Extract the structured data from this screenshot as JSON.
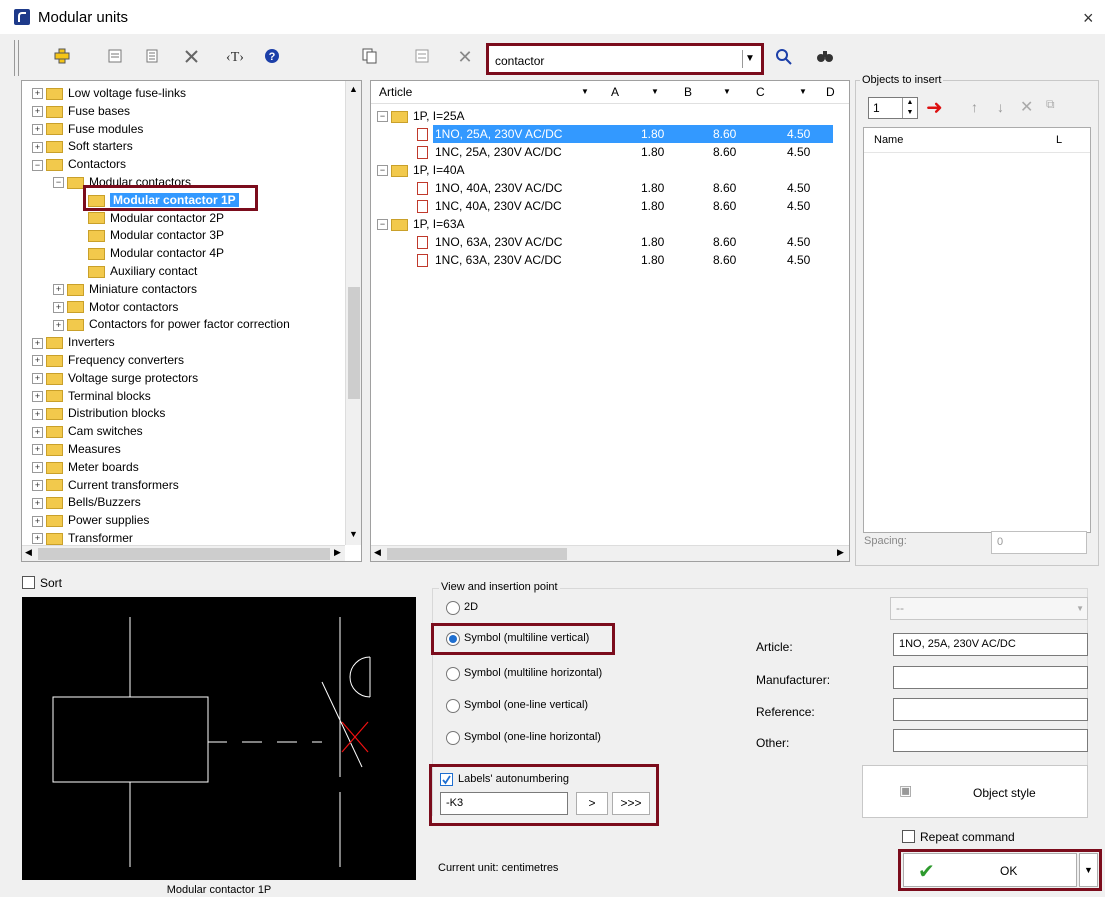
{
  "window": {
    "title": "Modular units",
    "close": "×"
  },
  "search": {
    "value": "contactor",
    "placeholder": ""
  },
  "tree": {
    "items": [
      {
        "label": "Low voltage fuse-links",
        "expander": "+"
      },
      {
        "label": "Fuse bases",
        "expander": "+"
      },
      {
        "label": "Fuse modules",
        "expander": "+"
      },
      {
        "label": "Soft starters",
        "expander": "+"
      },
      {
        "label": "Contactors",
        "expander": "−"
      },
      {
        "label": "Modular contactors",
        "expander": "−"
      },
      {
        "label": "Modular contactor 1P",
        "expander": ""
      },
      {
        "label": "Modular contactor 2P",
        "expander": ""
      },
      {
        "label": "Modular contactor 3P",
        "expander": ""
      },
      {
        "label": "Modular contactor 4P",
        "expander": ""
      },
      {
        "label": "Auxiliary contact",
        "expander": ""
      },
      {
        "label": "Miniature contactors",
        "expander": "+"
      },
      {
        "label": "Motor contactors",
        "expander": "+"
      },
      {
        "label": "Contactors for power factor correction",
        "expander": "+"
      },
      {
        "label": "Inverters",
        "expander": "+"
      },
      {
        "label": "Frequency converters",
        "expander": "+"
      },
      {
        "label": "Voltage surge protectors",
        "expander": "+"
      },
      {
        "label": "Terminal blocks",
        "expander": "+"
      },
      {
        "label": "Distribution blocks",
        "expander": "+"
      },
      {
        "label": "Cam switches",
        "expander": "+"
      },
      {
        "label": "Measures",
        "expander": "+"
      },
      {
        "label": "Meter boards",
        "expander": "+"
      },
      {
        "label": "Current transformers",
        "expander": "+"
      },
      {
        "label": "Bells/Buzzers",
        "expander": "+"
      },
      {
        "label": "Power supplies",
        "expander": "+"
      },
      {
        "label": "Transformer",
        "expander": "+"
      }
    ]
  },
  "articles": {
    "columns": [
      "Article",
      "A",
      "B",
      "C",
      "D"
    ],
    "groups": [
      {
        "label": "1P, I=25A",
        "rows": [
          {
            "name": "1NO, 25A, 230V AC/DC",
            "a": "1.80",
            "b": "8.60",
            "c": "4.50"
          },
          {
            "name": "1NC, 25A, 230V AC/DC",
            "a": "1.80",
            "b": "8.60",
            "c": "4.50"
          }
        ]
      },
      {
        "label": "1P, I=40A",
        "rows": [
          {
            "name": "1NO, 40A, 230V AC/DC",
            "a": "1.80",
            "b": "8.60",
            "c": "4.50"
          },
          {
            "name": "1NC, 40A, 230V AC/DC",
            "a": "1.80",
            "b": "8.60",
            "c": "4.50"
          }
        ]
      },
      {
        "label": "1P, I=63A",
        "rows": [
          {
            "name": "1NO, 63A, 230V AC/DC",
            "a": "1.80",
            "b": "8.60",
            "c": "4.50"
          },
          {
            "name": "1NC, 63A, 230V AC/DC",
            "a": "1.80",
            "b": "8.60",
            "c": "4.50"
          }
        ]
      }
    ]
  },
  "objects_to_insert": {
    "title": "Objects to insert",
    "count": "1",
    "col_name": "Name",
    "col_l": "L",
    "spacing_label": "Spacing:",
    "spacing_value": "0"
  },
  "sort_label": "Sort",
  "preview_caption": "Modular contactor 1P",
  "view": {
    "group_title": "View and insertion point",
    "options": [
      "2D",
      "Symbol (multiline vertical)",
      "Symbol (multiline horizontal)",
      "Symbol (one-line vertical)",
      "Symbol (one-line horizontal)"
    ],
    "selected": "Symbol (multiline vertical)",
    "combo_value": "--"
  },
  "props": {
    "article_label": "Article:",
    "article_value": "1NO, 25A, 230V AC/DC",
    "manufacturer_label": "Manufacturer:",
    "reference_label": "Reference:",
    "other_label": "Other:"
  },
  "labels": {
    "autonumber_label": "Labels' autonumbering",
    "value": "-K3",
    "btn_next": ">",
    "btn_more": ">>>"
  },
  "object_style_label": "Object style",
  "repeat_label": "Repeat command",
  "current_unit": "Current unit: centimetres",
  "ok_label": "OK",
  "toolbar_left": [
    "cross-plus",
    "card",
    "list",
    "tools",
    "T",
    "?"
  ],
  "colors": {
    "accent": "#7b0c1c",
    "selection": "#3399ff"
  }
}
